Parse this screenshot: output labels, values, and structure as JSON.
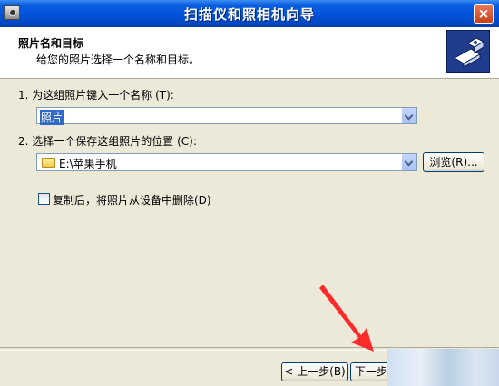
{
  "window": {
    "title": "扫描仪和照相机向导",
    "close_label": "×"
  },
  "header": {
    "title": "照片名和目标",
    "subtitle": "给您的照片选择一个名称和目标。"
  },
  "step1": {
    "label": "1.  为这组照片键入一个名称 (T):",
    "value": "照片"
  },
  "step2": {
    "label": "2.  选择一个保存这组照片的位置 (C):",
    "value": "E:\\苹果手机",
    "browse_label": "浏览(R)..."
  },
  "delete_option": {
    "label": "复制后，将照片从设备中删除(D)",
    "checked": false
  },
  "footer": {
    "back_label": "< 上一步(B)",
    "next_label": "下一步("
  },
  "colors": {
    "titlebar": "#0353d8",
    "annotation_arrow": "#ff2a2a",
    "selection": "#316ac5"
  }
}
